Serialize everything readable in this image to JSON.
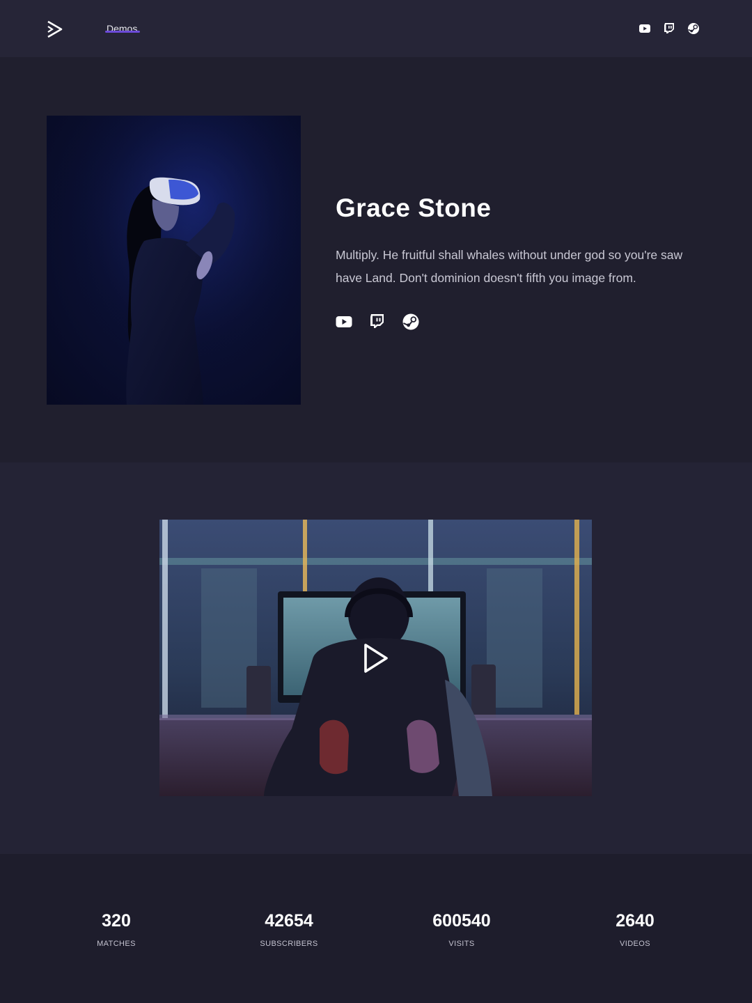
{
  "header": {
    "nav_demos": "Demos",
    "social_icons": [
      "youtube-icon",
      "twitch-icon",
      "steam-icon"
    ]
  },
  "profile": {
    "name": "Grace Stone",
    "bio": "Multiply. He fruitful shall whales without under god so you're saw have Land. Don't dominion doesn't fifth you image from.",
    "social_icons": [
      "youtube-icon",
      "twitch-icon",
      "steam-icon"
    ]
  },
  "stats": [
    {
      "value": "320",
      "label": "MATCHES"
    },
    {
      "value": "42654",
      "label": "SUBSCRIBERS"
    },
    {
      "value": "600540",
      "label": "VISITS"
    },
    {
      "value": "2640",
      "label": "VIDEOS"
    }
  ],
  "colors": {
    "background": "#201f2e",
    "header": "#262537",
    "accent": "#6c4bd9",
    "text": "#ffffff",
    "muted_text": "#c9c8d4"
  }
}
